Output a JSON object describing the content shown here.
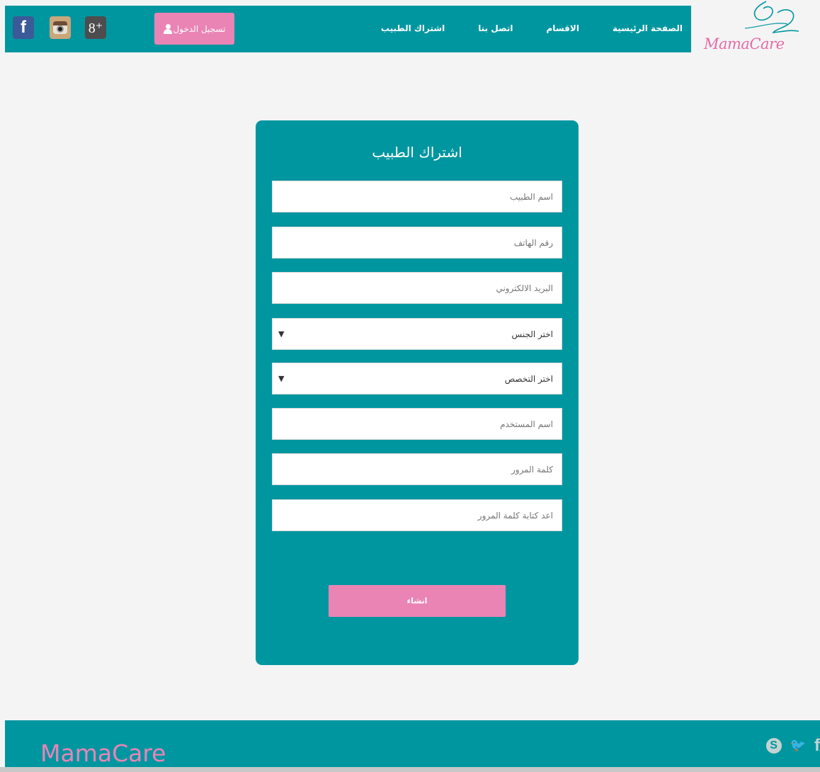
{
  "brand": {
    "logo_text": "MamaCare",
    "footer_text": "MamaCare"
  },
  "nav": {
    "items": [
      "الصفحة الرئيسية",
      "الاقسام",
      "اتصل بنا",
      "اشتراك الطبيب"
    ],
    "login_label": "تسجيل الدخول"
  },
  "social": {
    "facebook": "f",
    "googleplus": "8⁺"
  },
  "form": {
    "title": "اشتراك الطبيب",
    "doctor_name_placeholder": "اسم الطبيب",
    "phone_placeholder": "رقم الهاتف",
    "email_placeholder": "البريد الالكتروني",
    "gender_selected": "اختر الجنس",
    "specialty_selected": "اختر التخصص",
    "username_placeholder": "اسم المستخدم",
    "password_placeholder": "كلمة المرور",
    "confirm_password_placeholder": "اعد كتابة كلمة المرور",
    "submit_label": "انشاء",
    "caret": "▼"
  },
  "footer_icons": {
    "skype": "S",
    "twitter": "🐦",
    "facebook": "f"
  },
  "colors": {
    "teal": "#0096a0",
    "pink": "#ea84b5",
    "background": "#f4f4f4"
  }
}
